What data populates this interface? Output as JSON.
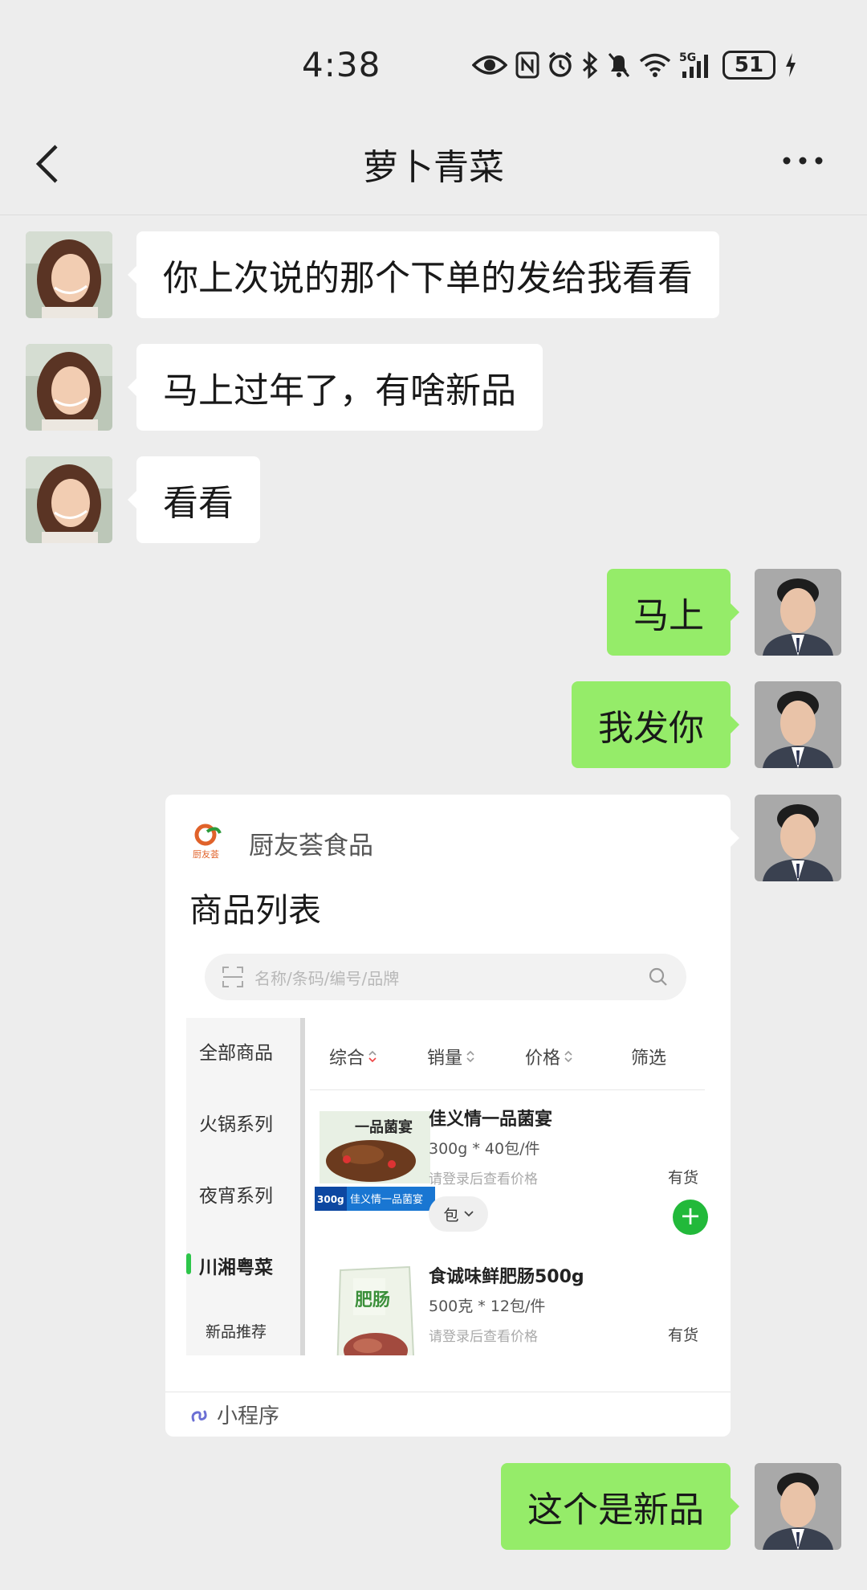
{
  "status_bar": {
    "time": "4:38",
    "battery": "51",
    "network": "5G"
  },
  "nav": {
    "title": "萝卜青菜"
  },
  "messages": [
    {
      "side": "left",
      "text": "你上次说的那个下单的发给我看看"
    },
    {
      "side": "left",
      "text": "马上过年了，有啥新品"
    },
    {
      "side": "left",
      "text": "看看"
    },
    {
      "side": "right",
      "text": "马上"
    },
    {
      "side": "right",
      "text": "我发你"
    },
    {
      "side": "right",
      "text": "这个是新品"
    }
  ],
  "mini_program": {
    "source": "厨友荟食品",
    "title": "商品列表",
    "search_placeholder": "名称/条码/编号/品牌",
    "categories": [
      "全部商品",
      "火锅系列",
      "夜宵系列",
      "川湘粤菜",
      "新品推荐"
    ],
    "active_category": "川湘粤菜",
    "sort_options": [
      "综合",
      "销量",
      "价格",
      "筛选"
    ],
    "products": [
      {
        "name": "佳义情一品菌宴",
        "spec": "300g * 40包/件",
        "price_note": "请登录后查看价格",
        "stock": "有货",
        "unit": "包",
        "image_label": "一品菌宴",
        "image_banner": "佳义情一品菌宴",
        "image_badge": "300g"
      },
      {
        "name": "食诚味鲜肥肠500g",
        "spec": "500克 * 12包/件",
        "price_note": "请登录后查看价格",
        "stock": "有货",
        "image_label": "肥肠"
      }
    ],
    "footer_label": "小程序",
    "logo_text": "厨友荟"
  },
  "colors": {
    "background": "#ededed",
    "bubble_right": "#95ec69",
    "bubble_left": "#ffffff",
    "accent_green": "#22b93a"
  }
}
